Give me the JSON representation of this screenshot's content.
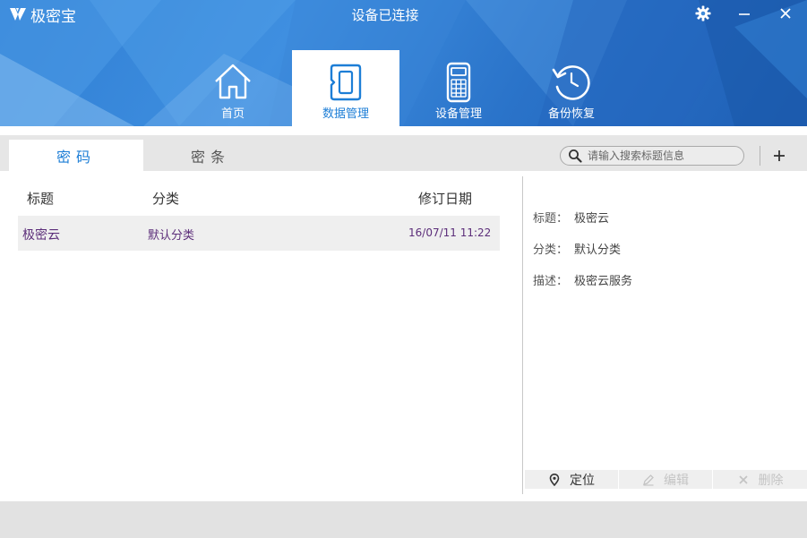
{
  "app": {
    "name": "极密宝",
    "status": "设备已连接"
  },
  "nav": {
    "tabs": [
      {
        "label": "首页",
        "icon": "home-icon",
        "active": false
      },
      {
        "label": "数据管理",
        "icon": "sd-card-icon",
        "active": true
      },
      {
        "label": "设备管理",
        "icon": "device-icon",
        "active": false
      },
      {
        "label": "备份恢复",
        "icon": "restore-icon",
        "active": false
      }
    ]
  },
  "subtabs": [
    {
      "label": "密码",
      "active": true
    },
    {
      "label": "密条",
      "active": false
    }
  ],
  "search": {
    "placeholder": "请输入搜索标题信息"
  },
  "list": {
    "headers": {
      "title": "标题",
      "category": "分类",
      "date": "修订日期"
    },
    "rows": [
      {
        "title": "极密云",
        "category": "默认分类",
        "date": "16/07/11 11:22"
      }
    ]
  },
  "detail": {
    "title_label": "标题：",
    "title_value": "极密云",
    "category_label": "分类：",
    "category_value": "默认分类",
    "desc_label": "描述：",
    "desc_value": "极密云服务"
  },
  "actions": {
    "locate": "定位",
    "edit": "编辑",
    "delete": "删除"
  },
  "colors": {
    "accent": "#1d7ed6",
    "header_blue": "#2f7ed3",
    "row_text": "#5c2e7a"
  }
}
